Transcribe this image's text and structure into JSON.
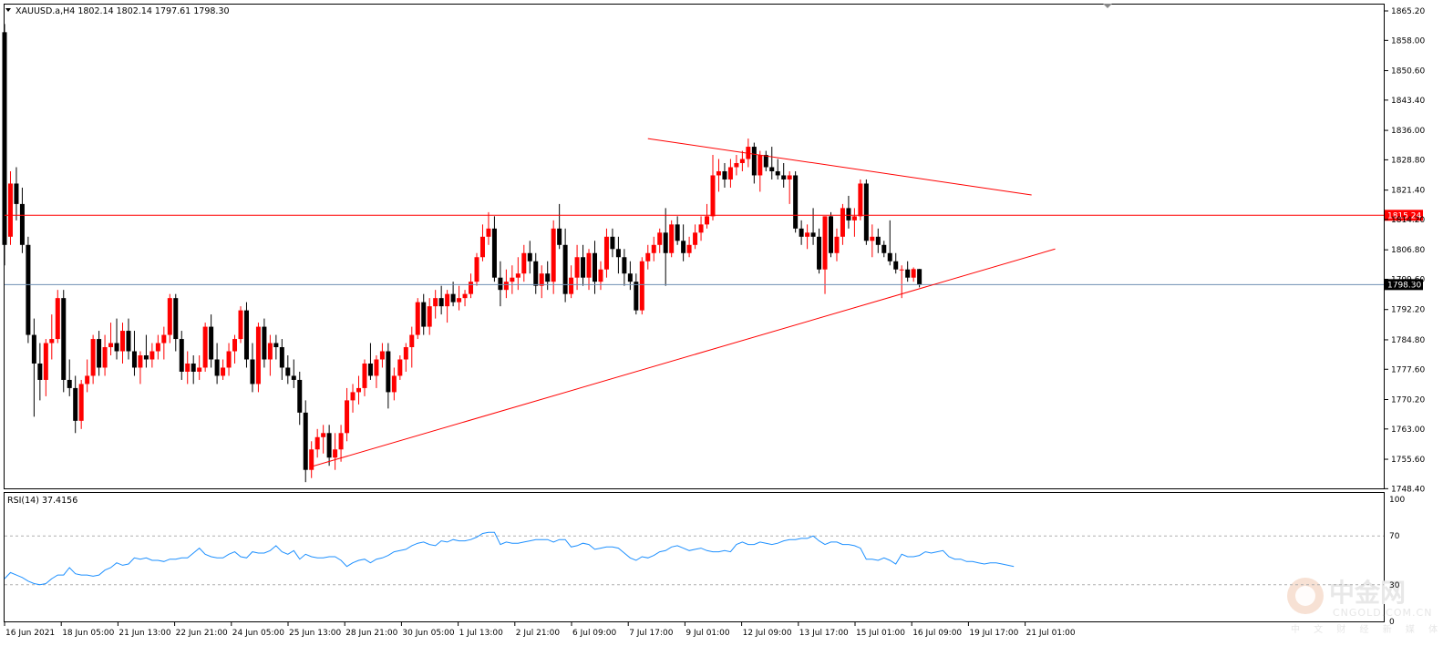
{
  "header": {
    "symbol_info": "XAUUSD.a,H4  1802.14 1802.14 1797.61 1798.30",
    "menu_icon": "triangle-down-icon"
  },
  "rsi": {
    "label": "RSI(14) 37.4156",
    "levels": [
      100,
      70,
      30,
      0
    ],
    "level_labels": [
      "100",
      "70",
      "30",
      "0"
    ]
  },
  "watermark": {
    "chinese": "中金网",
    "domain": "CNGOLD.COM.CN",
    "tagline": "中 文 财 经 新 媒 体",
    "logo_icon": "cngold-logo-icon"
  },
  "colors": {
    "bull": "#ff0000",
    "bear": "#000000",
    "trendline": "#ff0000",
    "bid_line": "#6e8fb3",
    "rsi_line": "#1e90ff",
    "current_price_tag_bg": "#000000",
    "resistance_tag_bg": "#ff0000"
  },
  "chart_data": [
    {
      "type": "candlestick",
      "ylim": [
        1748.48,
        1865.2
      ],
      "y_ticks": [
        "1865.20",
        "1858.00",
        "1850.60",
        "1843.40",
        "1836.00",
        "1828.80",
        "1821.40",
        "1814.20",
        "1806.80",
        "1799.60",
        "1792.20",
        "1784.80",
        "1777.60",
        "1770.20",
        "1763.00",
        "1755.60",
        "1748.40"
      ],
      "x_ticks": [
        "16 Jun 2021",
        "18 Jun 05:00",
        "21 Jun 13:00",
        "22 Jun 21:00",
        "24 Jun 05:00",
        "25 Jun 13:00",
        "28 Jun 21:00",
        "30 Jun 05:00",
        "1 Jul 13:00",
        "2 Jul 21:00",
        "6 Jul 09:00",
        "7 Jul 17:00",
        "9 Jul 01:00",
        "12 Jul 09:00",
        "13 Jul 17:00",
        "15 Jul 01:00",
        "16 Jul 09:00",
        "19 Jul 17:00",
        "21 Jul 01:00"
      ],
      "current_price": 1798.3,
      "current_price_label": "1798.30",
      "horizontal_level": 1815.24,
      "horizontal_level_label": "1815.24",
      "ohlc": [
        [
          1860.0,
          1862.0,
          1803.0,
          1808.0
        ],
        [
          1810.0,
          1826.0,
          1808.0,
          1823.0
        ],
        [
          1823.0,
          1827.0,
          1814.0,
          1818.0
        ],
        [
          1818.0,
          1822.0,
          1806.0,
          1808.0
        ],
        [
          1808.0,
          1810.0,
          1784.0,
          1786.0
        ],
        [
          1786.0,
          1790.0,
          1766.0,
          1779.0
        ],
        [
          1779.0,
          1784.0,
          1770.0,
          1775.0
        ],
        [
          1775.0,
          1785.0,
          1771.0,
          1784.0
        ],
        [
          1784.0,
          1791.0,
          1780.0,
          1785.0
        ],
        [
          1785.0,
          1797.0,
          1784.0,
          1795.0
        ],
        [
          1795.0,
          1797.0,
          1772.0,
          1775.0
        ],
        [
          1775.0,
          1780.0,
          1771.0,
          1773.0
        ],
        [
          1773.0,
          1776.0,
          1762.0,
          1765.0
        ],
        [
          1765.0,
          1775.0,
          1763.0,
          1774.0
        ],
        [
          1774.0,
          1780.0,
          1772.0,
          1776.0
        ],
        [
          1776.0,
          1786.0,
          1774.0,
          1785.0
        ],
        [
          1785.0,
          1787.0,
          1776.0,
          1778.0
        ],
        [
          1778.0,
          1786.0,
          1776.0,
          1783.0
        ],
        [
          1783.0,
          1789.0,
          1781.0,
          1784.0
        ],
        [
          1784.0,
          1790.0,
          1780.0,
          1782.0
        ],
        [
          1782.0,
          1789.0,
          1779.0,
          1787.0
        ],
        [
          1787.0,
          1790.0,
          1780.0,
          1782.0
        ],
        [
          1782.0,
          1787.0,
          1776.0,
          1778.0
        ],
        [
          1778.0,
          1782.0,
          1774.0,
          1781.0
        ],
        [
          1781.0,
          1786.0,
          1778.0,
          1780.0
        ],
        [
          1780.0,
          1784.0,
          1778.0,
          1782.0
        ],
        [
          1782.0,
          1786.0,
          1780.0,
          1784.0
        ],
        [
          1784.0,
          1788.0,
          1780.0,
          1786.0
        ],
        [
          1786.0,
          1796.0,
          1784.0,
          1795.0
        ],
        [
          1795.0,
          1796.0,
          1782.0,
          1785.0
        ],
        [
          1785.0,
          1787.0,
          1775.0,
          1777.0
        ],
        [
          1777.0,
          1782.0,
          1774.0,
          1779.0
        ],
        [
          1779.0,
          1781.0,
          1774.0,
          1777.0
        ],
        [
          1777.0,
          1781.0,
          1775.0,
          1778.0
        ],
        [
          1778.0,
          1789.0,
          1777.0,
          1788.0
        ],
        [
          1788.0,
          1791.0,
          1778.0,
          1780.0
        ],
        [
          1780.0,
          1784.0,
          1774.0,
          1776.0
        ],
        [
          1776.0,
          1780.0,
          1775.0,
          1778.0
        ],
        [
          1778.0,
          1784.0,
          1776.0,
          1782.0
        ],
        [
          1782.0,
          1786.0,
          1779.0,
          1785.0
        ],
        [
          1785.0,
          1793.0,
          1784.0,
          1792.0
        ],
        [
          1792.0,
          1794.0,
          1778.0,
          1780.0
        ],
        [
          1780.0,
          1784.0,
          1772.0,
          1774.0
        ],
        [
          1774.0,
          1789.0,
          1772.0,
          1788.0
        ],
        [
          1788.0,
          1790.0,
          1778.0,
          1780.0
        ],
        [
          1780.0,
          1786.0,
          1776.0,
          1784.0
        ],
        [
          1784.0,
          1786.0,
          1780.0,
          1783.0
        ],
        [
          1783.0,
          1785.0,
          1775.0,
          1778.0
        ],
        [
          1778.0,
          1781.0,
          1774.0,
          1776.0
        ],
        [
          1776.0,
          1780.0,
          1773.0,
          1775.0
        ],
        [
          1775.0,
          1777.0,
          1764.0,
          1767.0
        ],
        [
          1767.0,
          1770.0,
          1750.0,
          1753.0
        ],
        [
          1753.0,
          1760.0,
          1751.0,
          1758.0
        ],
        [
          1758.0,
          1763.0,
          1756.0,
          1761.0
        ],
        [
          1761.0,
          1764.0,
          1757.0,
          1762.0
        ],
        [
          1762.0,
          1764.0,
          1754.0,
          1756.0
        ],
        [
          1756.0,
          1762.0,
          1753.0,
          1758.0
        ],
        [
          1758.0,
          1764.0,
          1755.0,
          1762.0
        ],
        [
          1762.0,
          1773.0,
          1760.0,
          1770.0
        ],
        [
          1770.0,
          1774.0,
          1767.0,
          1772.0
        ],
        [
          1772.0,
          1776.0,
          1769.0,
          1773.0
        ],
        [
          1773.0,
          1780.0,
          1771.0,
          1779.0
        ],
        [
          1779.0,
          1784.0,
          1775.0,
          1776.0
        ],
        [
          1776.0,
          1781.0,
          1773.0,
          1780.0
        ],
        [
          1780.0,
          1784.0,
          1778.0,
          1782.0
        ],
        [
          1782.0,
          1784.0,
          1768.0,
          1772.0
        ],
        [
          1772.0,
          1778.0,
          1770.0,
          1776.0
        ],
        [
          1776.0,
          1781.0,
          1775.0,
          1780.0
        ],
        [
          1780.0,
          1784.0,
          1777.0,
          1783.0
        ],
        [
          1783.0,
          1788.0,
          1778.0,
          1786.0
        ],
        [
          1786.0,
          1795.0,
          1785.0,
          1794.0
        ],
        [
          1794.0,
          1796.0,
          1786.0,
          1788.0
        ],
        [
          1788.0,
          1795.0,
          1786.0,
          1793.0
        ],
        [
          1793.0,
          1797.0,
          1790.0,
          1795.0
        ],
        [
          1795.0,
          1798.0,
          1791.0,
          1793.0
        ],
        [
          1793.0,
          1797.0,
          1789.0,
          1796.0
        ],
        [
          1796.0,
          1799.0,
          1793.0,
          1794.0
        ],
        [
          1794.0,
          1798.0,
          1792.0,
          1795.0
        ],
        [
          1795.0,
          1797.0,
          1793.0,
          1796.0
        ],
        [
          1796.0,
          1801.0,
          1795.0,
          1799.0
        ],
        [
          1799.0,
          1806.0,
          1798.0,
          1805.0
        ],
        [
          1805.0,
          1813.0,
          1804.0,
          1810.0
        ],
        [
          1810.0,
          1816.0,
          1808.0,
          1812.0
        ],
        [
          1812.0,
          1815.0,
          1799.0,
          1800.0
        ],
        [
          1800.0,
          1804.0,
          1793.0,
          1797.0
        ],
        [
          1797.0,
          1802.0,
          1795.0,
          1799.0
        ],
        [
          1799.0,
          1803.0,
          1796.0,
          1800.0
        ],
        [
          1800.0,
          1805.0,
          1797.0,
          1801.0
        ],
        [
          1801.0,
          1808.0,
          1799.0,
          1806.0
        ],
        [
          1806.0,
          1809.0,
          1801.0,
          1804.0
        ],
        [
          1804.0,
          1806.0,
          1796.0,
          1798.0
        ],
        [
          1798.0,
          1803.0,
          1795.0,
          1801.0
        ],
        [
          1801.0,
          1804.0,
          1797.0,
          1799.0
        ],
        [
          1799.0,
          1814.0,
          1796.0,
          1812.0
        ],
        [
          1812.0,
          1818.0,
          1807.0,
          1808.0
        ],
        [
          1808.0,
          1812.0,
          1794.0,
          1796.0
        ],
        [
          1796.0,
          1803.0,
          1795.0,
          1800.0
        ],
        [
          1800.0,
          1808.0,
          1797.0,
          1805.0
        ],
        [
          1805.0,
          1808.0,
          1798.0,
          1800.0
        ],
        [
          1800.0,
          1807.0,
          1797.0,
          1806.0
        ],
        [
          1806.0,
          1809.0,
          1796.0,
          1799.0
        ],
        [
          1799.0,
          1804.0,
          1797.0,
          1802.0
        ],
        [
          1802.0,
          1812.0,
          1800.0,
          1810.0
        ],
        [
          1810.0,
          1812.0,
          1805.0,
          1807.0
        ],
        [
          1807.0,
          1810.0,
          1801.0,
          1805.0
        ],
        [
          1805.0,
          1807.0,
          1798.0,
          1801.0
        ],
        [
          1801.0,
          1804.0,
          1797.0,
          1799.0
        ],
        [
          1799.0,
          1801.0,
          1791.0,
          1792.0
        ],
        [
          1792.0,
          1805.0,
          1791.0,
          1804.0
        ],
        [
          1804.0,
          1808.0,
          1802.0,
          1806.0
        ],
        [
          1806.0,
          1810.0,
          1804.0,
          1808.0
        ],
        [
          1808.0,
          1812.0,
          1806.0,
          1811.0
        ],
        [
          1811.0,
          1817.0,
          1798.0,
          1806.0
        ],
        [
          1806.0,
          1814.0,
          1805.0,
          1813.0
        ],
        [
          1813.0,
          1815.0,
          1808.0,
          1809.0
        ],
        [
          1809.0,
          1813.0,
          1804.0,
          1806.0
        ],
        [
          1806.0,
          1810.0,
          1805.0,
          1808.0
        ],
        [
          1808.0,
          1813.0,
          1807.0,
          1811.0
        ],
        [
          1811.0,
          1815.0,
          1809.0,
          1813.0
        ],
        [
          1813.0,
          1818.0,
          1812.0,
          1815.0
        ],
        [
          1815.0,
          1830.0,
          1814.0,
          1825.0
        ],
        [
          1825.0,
          1829.0,
          1821.0,
          1826.0
        ],
        [
          1826.0,
          1828.0,
          1822.0,
          1824.0
        ],
        [
          1824.0,
          1829.0,
          1822.0,
          1827.0
        ],
        [
          1827.0,
          1830.0,
          1825.0,
          1828.0
        ],
        [
          1828.0,
          1831.0,
          1826.0,
          1829.0
        ],
        [
          1829.0,
          1834.0,
          1827.0,
          1832.0
        ],
        [
          1832.0,
          1833.0,
          1823.0,
          1825.0
        ],
        [
          1825.0,
          1831.0,
          1821.0,
          1830.0
        ],
        [
          1830.0,
          1831.0,
          1826.0,
          1827.0
        ],
        [
          1827.0,
          1832.0,
          1824.0,
          1826.0
        ],
        [
          1826.0,
          1829.0,
          1824.0,
          1825.0
        ],
        [
          1825.0,
          1828.0,
          1822.0,
          1824.0
        ],
        [
          1824.0,
          1826.0,
          1818.0,
          1825.0
        ],
        [
          1825.0,
          1826.0,
          1811.0,
          1812.0
        ],
        [
          1812.0,
          1814.0,
          1808.0,
          1810.0
        ],
        [
          1810.0,
          1813.0,
          1807.0,
          1811.0
        ],
        [
          1811.0,
          1817.0,
          1808.0,
          1810.0
        ],
        [
          1810.0,
          1812.0,
          1801.0,
          1802.0
        ],
        [
          1802.0,
          1815.0,
          1796.0,
          1815.0
        ],
        [
          1815.0,
          1816.0,
          1805.0,
          1806.0
        ],
        [
          1806.0,
          1812.0,
          1804.0,
          1810.0
        ],
        [
          1810.0,
          1818.0,
          1808.0,
          1817.0
        ],
        [
          1817.0,
          1820.0,
          1812.0,
          1814.0
        ],
        [
          1814.0,
          1817.0,
          1810.0,
          1815.0
        ],
        [
          1815.0,
          1824.0,
          1814.0,
          1823.0
        ],
        [
          1823.0,
          1824.0,
          1808.0,
          1809.0
        ],
        [
          1809.0,
          1813.0,
          1805.0,
          1810.0
        ],
        [
          1810.0,
          1812.0,
          1806.0,
          1808.0
        ],
        [
          1808.0,
          1809.0,
          1805.0,
          1806.0
        ],
        [
          1806.0,
          1814.0,
          1803.0,
          1804.0
        ],
        [
          1804.0,
          1806.0,
          1801.0,
          1802.0
        ],
        [
          1802.0,
          1803.0,
          1795.0,
          1802.0
        ],
        [
          1802.0,
          1804.0,
          1799.0,
          1800.0
        ],
        [
          1800.0,
          1802.5,
          1799.0,
          1802.1
        ],
        [
          1802.1,
          1802.14,
          1797.61,
          1798.3
        ]
      ],
      "trendlines": [
        {
          "name": "rising-support",
          "from": [
            52,
            1753.8
          ],
          "to": [
            178,
            1807.0
          ]
        },
        {
          "name": "falling-resistance",
          "from": [
            109,
            1834.0
          ],
          "to": [
            174,
            1820.2
          ]
        }
      ]
    },
    {
      "type": "line",
      "title": "RSI(14) 37.4156",
      "ylim": [
        0,
        100
      ],
      "levels": [
        70,
        30
      ],
      "values": [
        35,
        40,
        38,
        36,
        33,
        31,
        30,
        31,
        35,
        38,
        38,
        44,
        39,
        38,
        38,
        37,
        38,
        42,
        44,
        48,
        46,
        47,
        52,
        51,
        52,
        50,
        50,
        49,
        51,
        51,
        52,
        52,
        56,
        60,
        55,
        53,
        52,
        52,
        55,
        57,
        53,
        52,
        57,
        56,
        56,
        58,
        62,
        57,
        55,
        58,
        51,
        55,
        53,
        52,
        52,
        53,
        53,
        50,
        45,
        48,
        50,
        51,
        48,
        51,
        52,
        54,
        57,
        58,
        59,
        62,
        64,
        65,
        63,
        62,
        66,
        65,
        67,
        66,
        66,
        67,
        69,
        72,
        73,
        73,
        63,
        65,
        64,
        64,
        65,
        66,
        67,
        67,
        67,
        65,
        67,
        67,
        61,
        62,
        64,
        63,
        59,
        60,
        61,
        61,
        60,
        56,
        52,
        50,
        53,
        52,
        54,
        57,
        58,
        61,
        62,
        60,
        58,
        59,
        60,
        58,
        57,
        57,
        58,
        57,
        63,
        65,
        63,
        63,
        65,
        64,
        63,
        64,
        66,
        67,
        67,
        68,
        68,
        70,
        66,
        63,
        65,
        65,
        63,
        63,
        62,
        60,
        51,
        51,
        50,
        52,
        50,
        47,
        55,
        53,
        53,
        54,
        57,
        56,
        57,
        58,
        53,
        51,
        51,
        49,
        49,
        48,
        47,
        48,
        48,
        47,
        46,
        45
      ]
    }
  ]
}
